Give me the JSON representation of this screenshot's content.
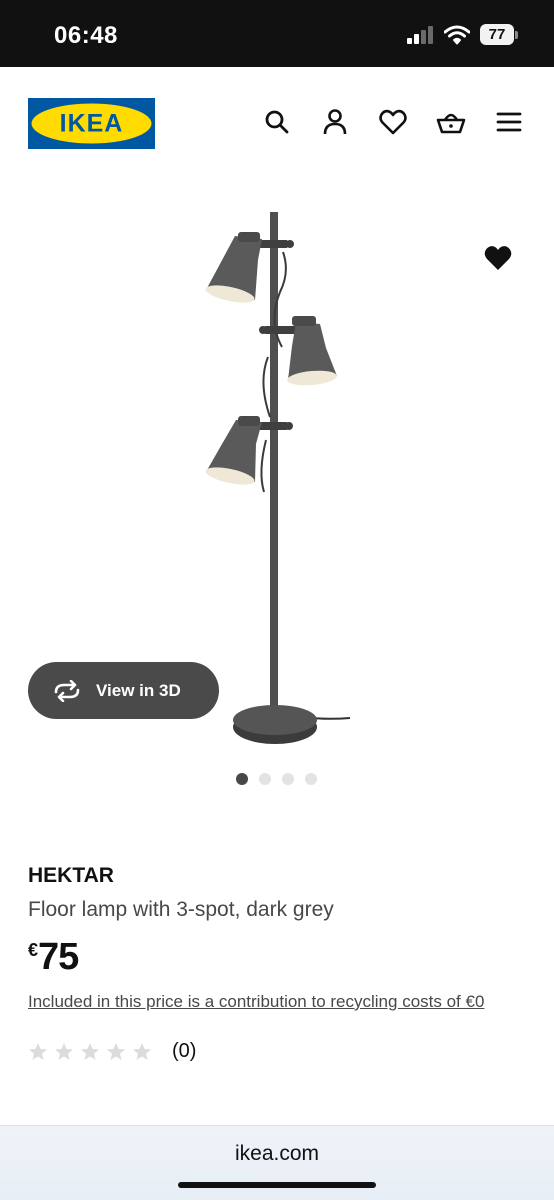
{
  "status_bar": {
    "time": "06:48",
    "battery": "77"
  },
  "header": {
    "logo_text": "IKEA",
    "brand_colors": {
      "blue": "#0058A3",
      "yellow": "#FFDB00"
    },
    "icons": [
      "search-icon",
      "account-icon",
      "heart-icon",
      "basket-icon",
      "menu-icon"
    ]
  },
  "gallery": {
    "view_3d_label": "View in 3D",
    "image_count": 4,
    "active_index": 0
  },
  "product": {
    "name": "HEKTAR",
    "description": "Floor lamp with 3-spot, dark grey",
    "price_currency": "€",
    "price_value": "75",
    "recycle_note": "Included in this price is a contribution to recycling costs of €0",
    "rating_stars": 0,
    "rating_count": "(0)"
  },
  "browser": {
    "url": "ikea.com"
  }
}
